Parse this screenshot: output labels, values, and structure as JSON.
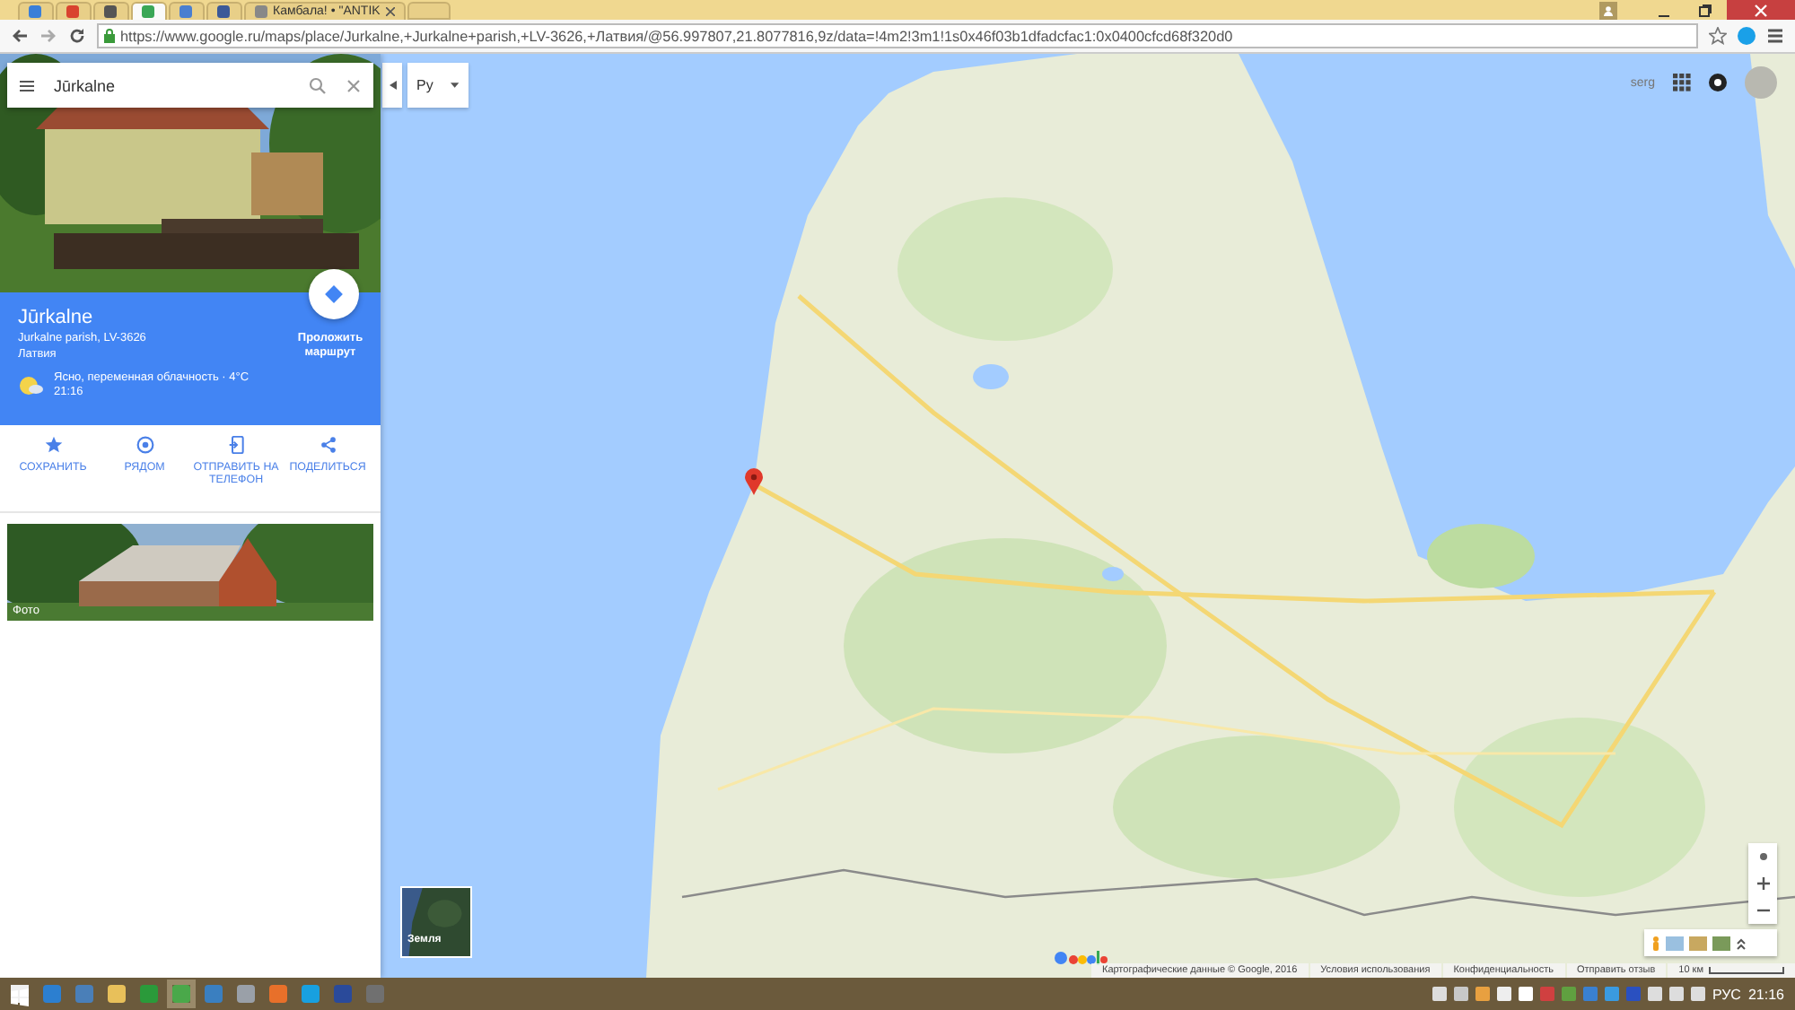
{
  "browser": {
    "tabs": [
      {
        "selected": false
      },
      {
        "selected": false
      },
      {
        "selected": false
      },
      {
        "selected": true
      },
      {
        "selected": false
      },
      {
        "selected": false
      },
      {
        "label": "Камбала! • \"ANTIK",
        "selected": false
      }
    ],
    "url": "https://www.google.ru/maps/place/Jurkalne,+Jurkalne+parish,+LV-3626,+Латвия/@56.997807,21.8077816,9z/data=!4m2!3m1!1s0x46f03b1dfadcfac1:0x0400cfcd68f320d0"
  },
  "panel": {
    "search": {
      "value": "Jūrkalne"
    },
    "place": {
      "name": "Jūrkalne",
      "address": "Jurkalne parish, LV-3626",
      "country": "Латвия",
      "weather": "Ясно, переменная облачность · 4°C",
      "time": "21:16"
    },
    "directions": "Проложить маршрут",
    "actions": [
      {
        "label": "СОХРАНИТЬ"
      },
      {
        "label": "РЯДОМ"
      },
      {
        "label": "ОТПРАВИТЬ НА ТЕЛЕФОН"
      },
      {
        "label": "ПОДЕЛИТЬСЯ"
      }
    ],
    "photo_caption": "Фото"
  },
  "map": {
    "language": "Ру",
    "user": "serg",
    "layer_label": "Земля",
    "attribution": [
      "Картографические данные © Google, 2016",
      "Условия использования",
      "Конфиденциальность",
      "Отправить отзыв"
    ],
    "scale": "10 км"
  },
  "taskbar": {
    "language": "РУС",
    "clock": "21:16"
  }
}
